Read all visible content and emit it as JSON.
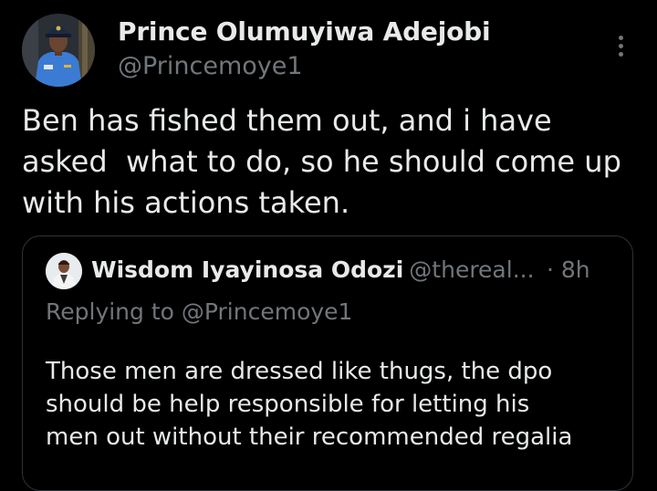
{
  "tweet": {
    "author": {
      "display_name": "Prince Olumuyiwa Adejobi",
      "handle": "@Princemoye1"
    },
    "more_icon": "more-vertical-icon",
    "text_lines": [
      "Ben has fished them out, and i have",
      "asked  what to do, so he should come up",
      "with his actions taken."
    ]
  },
  "quote": {
    "author": {
      "display_name": "Wisdom Iyayinosa Odozi",
      "handle": "@thereal...",
      "time": "· 8h"
    },
    "replying_to": "Replying to @Princemoye1",
    "text_lines": [
      "Those men are dressed like thugs, the dpo",
      "should be help responsible for letting his",
      "men out without their recommended regalia"
    ]
  },
  "colors": {
    "background": "#000000",
    "primary_text": "#e7e9ea",
    "secondary_text": "#71767b",
    "border": "#2f3336",
    "uniform_blue": "#3b7bd3"
  }
}
